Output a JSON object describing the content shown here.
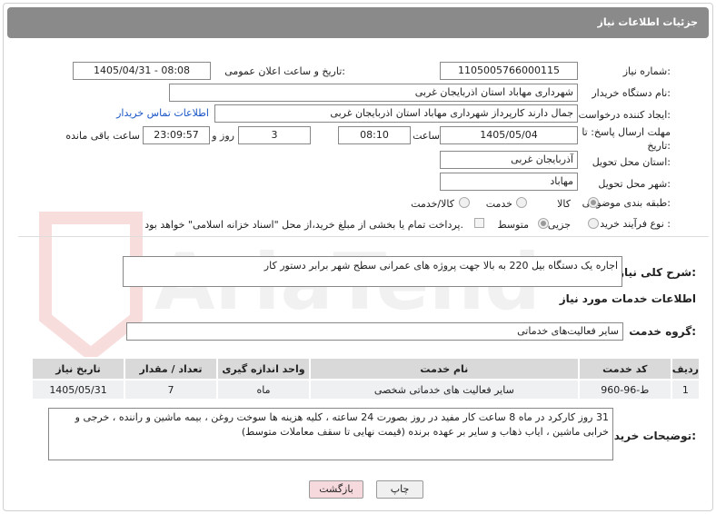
{
  "header": {
    "title": "جزئیات اطلاعات نیاز"
  },
  "fields": {
    "need_number_label": "شماره نیاز:",
    "need_number": "1105005766000115",
    "announce_label": "تاریخ و ساعت اعلان عمومی:",
    "announce_value": "1405/04/31 - 08:08",
    "buyer_org_label": "نام دستگاه خریدار:",
    "buyer_org": "شهرداری مهاباد استان اذربایجان غربی",
    "creator_label": "ایجاد کننده درخواست:",
    "creator": "جمال دارند کارپرداز  شهرداری مهاباد استان اذربایجان غربی",
    "contact_link": "اطلاعات تماس خریدار",
    "deadline_label": "مهلت ارسال پاسخ: تا تاریخ:",
    "deadline_date": "1405/05/04",
    "time_label": "ساعت",
    "deadline_time": "08:10",
    "days_value": "3",
    "days_label": "روز و",
    "remaining_time": "23:09:57",
    "remaining_label": "ساعت باقی مانده",
    "province_label": "استان محل تحویل:",
    "province": "آذربایجان غربی",
    "city_label": "شهر محل تحویل:",
    "city": "مهاباد",
    "category_label": "طبقه بندی موضوعی:",
    "category_options": [
      "کالا",
      "خدمت",
      "کالا/خدمت"
    ],
    "process_label": "نوع فرآیند خرید :",
    "process_options": [
      "جزیی",
      "متوسط"
    ],
    "payment_note": "پرداخت تمام یا بخشی از مبلغ خرید،از محل \"اسناد خزانه اسلامی\" خواهد بود."
  },
  "description": {
    "label": "شرح کلی نیاز:",
    "text": "اجاره یک دستگاه بیل 220 به بالا جهت پروژه های عمرانی سطح شهر برابر دستور کار"
  },
  "services": {
    "section_title": "اطلاعات خدمات مورد نیاز",
    "group_label": "گروه خدمت:",
    "group_value": "سایر فعالیت‌های خدماتی",
    "columns": [
      "ردیف",
      "کد خدمت",
      "نام خدمت",
      "واحد اندازه گیری",
      "تعداد / مقدار",
      "تاریخ نیاز"
    ],
    "rows": [
      {
        "row": "1",
        "code": "ط-96-960",
        "name": "سایر فعالیت های خدماتی شخصی",
        "unit": "ماه",
        "qty": "7",
        "date": "1405/05/31"
      }
    ]
  },
  "buyer_notes": {
    "label": "توضیحات خریدار:",
    "text": "31 روز کارکرد در ماه 8 ساعت کار مفید در روز بصورت 24 ساعته ، کلیه هزینه ها سوخت روغن ، بیمه ماشین و راننده ، خرجی و خرابی ماشین ، ایاب ذهاب و سایر بر عهده برنده  (قیمت نهایی تا سقف معاملات متوسط)"
  },
  "buttons": {
    "print": "چاپ",
    "back": "بازگشت"
  },
  "watermark": "AriaTender.net"
}
